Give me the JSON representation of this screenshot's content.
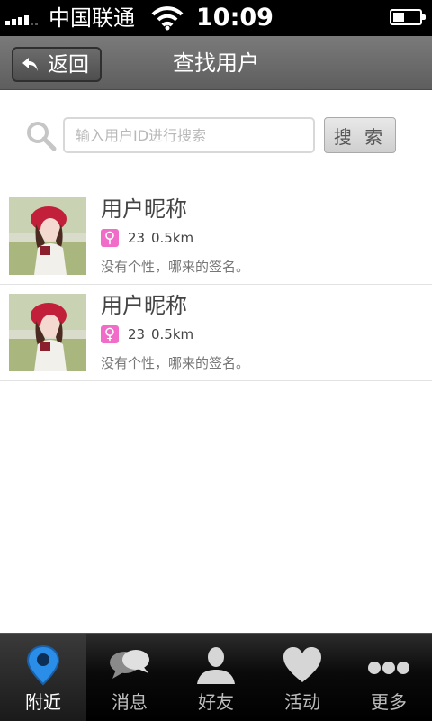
{
  "status_bar": {
    "carrier": "中国联通",
    "time": "10:09"
  },
  "nav": {
    "back_label": "返回",
    "title": "查找用户"
  },
  "search": {
    "placeholder": "输入用户ID进行搜索",
    "value": "",
    "button_label": "搜 索"
  },
  "results": [
    {
      "nickname": "用户昵称",
      "gender_symbol": "♀",
      "age": "23",
      "distance": "0.5km",
      "signature": "没有个性，哪来的签名。"
    },
    {
      "nickname": "用户昵称",
      "gender_symbol": "♀",
      "age": "23",
      "distance": "0.5km",
      "signature": "没有个性，哪来的签名。"
    }
  ],
  "tabs": [
    {
      "label": "附近",
      "icon": "location-pin-icon",
      "active": true
    },
    {
      "label": "消息",
      "icon": "chat-bubbles-icon",
      "active": false
    },
    {
      "label": "好友",
      "icon": "person-icon",
      "active": false
    },
    {
      "label": "活动",
      "icon": "heart-icon",
      "active": false
    },
    {
      "label": "更多",
      "icon": "more-dots-icon",
      "active": false
    }
  ],
  "colors": {
    "nav_bar": "#6b6b6b",
    "gender_female": "#f06cc8",
    "active_tab_icon": "#2a8ee8"
  }
}
